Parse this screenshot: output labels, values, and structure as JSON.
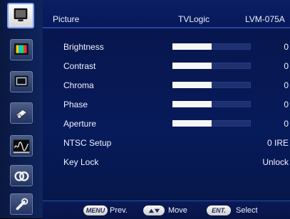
{
  "header": {
    "section": "Picture",
    "brand": "TVLogic",
    "model": "LVM-075A"
  },
  "sidebar": {
    "items": [
      {
        "icon": "picture-monitor-icon",
        "active": true
      },
      {
        "icon": "color-test-pattern-icon",
        "active": false
      },
      {
        "icon": "marker-frame-icon",
        "active": false
      },
      {
        "icon": "audio-speaker-icon",
        "active": false
      },
      {
        "icon": "waveform-icon",
        "active": false
      },
      {
        "icon": "link-rings-icon",
        "active": false
      },
      {
        "icon": "wrench-tools-icon",
        "active": false
      }
    ]
  },
  "menu": {
    "rows": [
      {
        "label": "Brightness",
        "value": "0",
        "level": 0.5
      },
      {
        "label": "Contrast",
        "value": "0",
        "level": 0.5
      },
      {
        "label": "Chroma",
        "value": "0",
        "level": 0.5
      },
      {
        "label": "Phase",
        "value": "0",
        "level": 0.5
      },
      {
        "label": "Aperture",
        "value": "0",
        "level": 0.5
      },
      {
        "label": "NTSC Setup",
        "value": "0 IRE"
      },
      {
        "label": "Key Lock",
        "value": "Unlock"
      }
    ]
  },
  "footer": {
    "menu_key": "MENU",
    "menu_action": "Prev.",
    "move_action": "Move",
    "ent_key": "ENT.",
    "ent_action": "Select"
  },
  "colors": {
    "panel_bg": "#071a5a",
    "sidebar_bg": "#10245c",
    "bar_fill": "#f6f6f6",
    "accent": "#7aa2ff"
  }
}
